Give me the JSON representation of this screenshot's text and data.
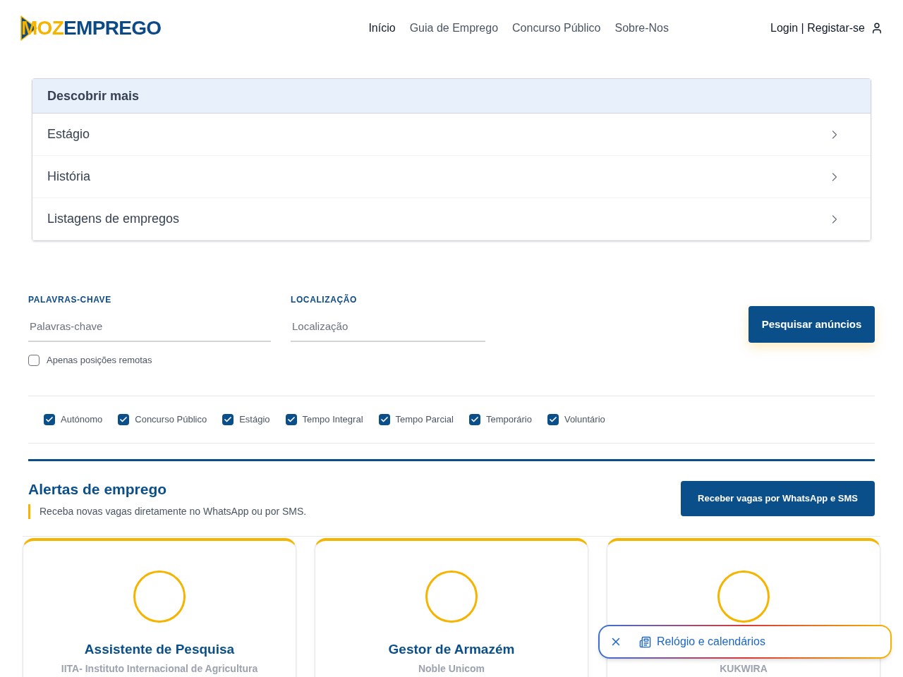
{
  "logo": {
    "accent": "MOZ",
    "main": "EMPREGO"
  },
  "nav": [
    {
      "label": "Início",
      "selected": true
    },
    {
      "label": "Guia de Emprego",
      "selected": false
    },
    {
      "label": "Concurso Público",
      "selected": false
    },
    {
      "label": "Sobre-Nos",
      "selected": false
    }
  ],
  "account": {
    "label": "Login | Registar-se"
  },
  "discover": {
    "title": "Descobrir mais",
    "items": [
      "Estágio",
      "História",
      "Listagens de empregos"
    ]
  },
  "search": {
    "keywords": {
      "label": "PALAVRAS-CHAVE",
      "placeholder": "Palavras-chave"
    },
    "location": {
      "label": "LOCALIZAÇÃO",
      "placeholder": "Localização"
    },
    "button": "Pesquisar anúncios",
    "remote": {
      "label": "Apenas posições remotas",
      "checked": false
    }
  },
  "job_types": [
    {
      "label": "Autónomo",
      "checked": true
    },
    {
      "label": "Concurso Público",
      "checked": true
    },
    {
      "label": "Estágio",
      "checked": true
    },
    {
      "label": "Tempo Integral",
      "checked": true
    },
    {
      "label": "Tempo Parcial",
      "checked": true
    },
    {
      "label": "Temporário",
      "checked": true
    },
    {
      "label": "Voluntário",
      "checked": true
    }
  ],
  "alerts": {
    "title": "Alertas de emprego",
    "subtitle": "Receba novas vagas diretamente no WhatsApp ou por SMS.",
    "button": "Receber vagas por WhatsApp e SMS"
  },
  "jobs": [
    {
      "title": "Assistente de Pesquisa",
      "company": "IITA- Instituto Internacional de Agricultura"
    },
    {
      "title": "Gestor de Armazém",
      "company": "Noble Unicom"
    },
    {
      "company": "KUKWIRA"
    }
  ],
  "popup": {
    "label": "Relógio e calendários"
  }
}
